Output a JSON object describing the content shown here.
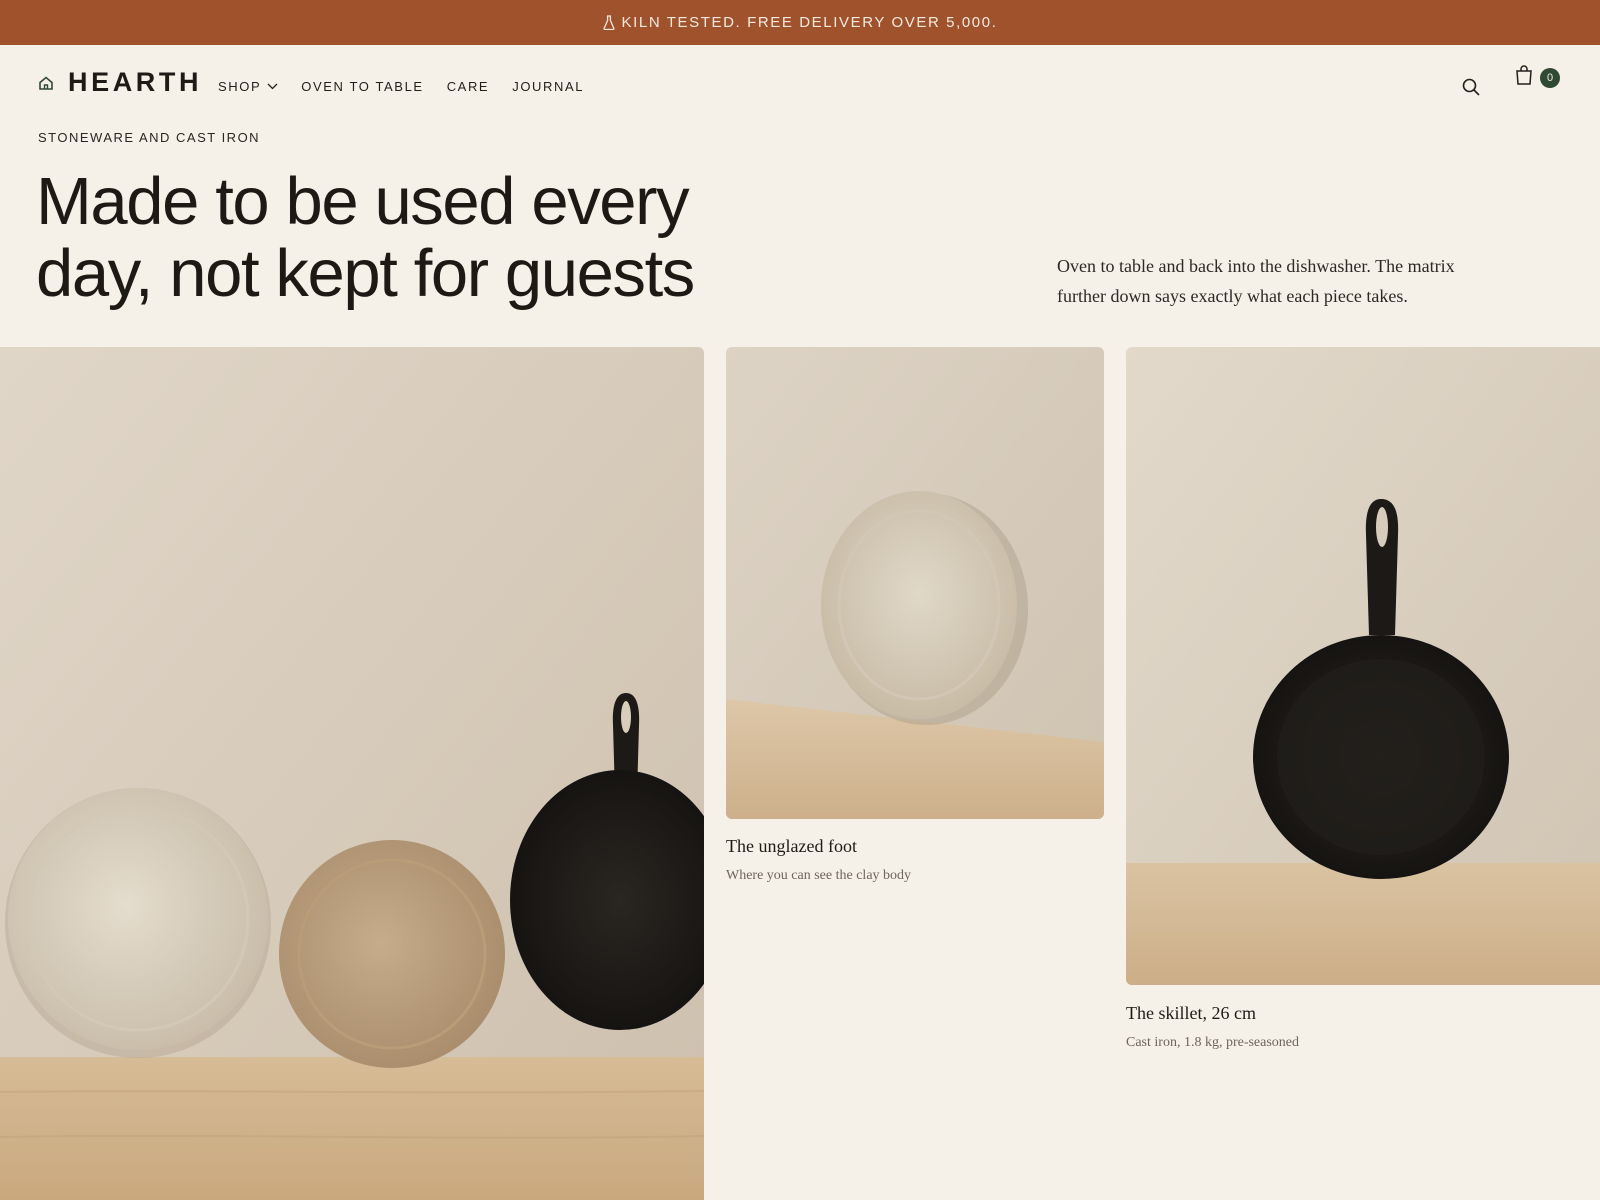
{
  "announcement": {
    "icon": "flask-icon",
    "text": "KILN TESTED. FREE DELIVERY OVER 5,000."
  },
  "header": {
    "logo_text": "HEARTH",
    "logo_icon": "home-icon",
    "nav": [
      {
        "label": "SHOP",
        "has_dropdown": true
      },
      {
        "label": "OVEN TO TABLE"
      },
      {
        "label": "CARE"
      },
      {
        "label": "JOURNAL"
      }
    ],
    "search_icon": "search-icon",
    "cart_icon": "shopping-bag-icon",
    "cart_count": "0"
  },
  "hero": {
    "eyebrow": "STONEWARE AND CAST IRON",
    "headline_line1": "Made to be used every",
    "headline_line2": "day, not kept for guests",
    "intro": "Oven to table and back into the dishwasher. The matrix further down says exactly what each piece takes."
  },
  "gallery": [
    {
      "image": "plates-and-skillet-photo"
    },
    {
      "image": "plate-leaning-photo",
      "title": "The unglazed foot",
      "subtitle": "Where you can see the clay body"
    },
    {
      "image": "skillet-photo",
      "title": "The skillet, 26 cm",
      "subtitle": "Cast iron, 1.8 kg, pre-seasoned"
    }
  ],
  "colors": {
    "announcement_bg": "#a0522d",
    "page_bg": "#f6f1e8",
    "badge_bg": "#2f4a33",
    "text": "#1d1a15"
  }
}
